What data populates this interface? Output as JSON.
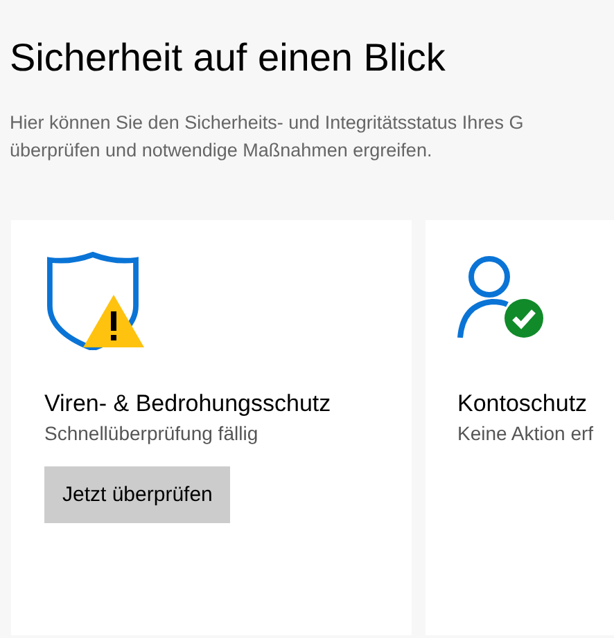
{
  "title": "Sicherheit auf einen Blick",
  "description_lines": [
    "Hier können Sie den Sicherheits- und Integritätsstatus Ihres G",
    "überprüfen und notwendige Maßnahmen ergreifen."
  ],
  "cards": [
    {
      "kind": "warning",
      "title": "Viren- & Bedrohungsschutz",
      "status": "Schnellüberprüfung fällig",
      "button": "Jetzt überprüfen"
    },
    {
      "kind": "ok",
      "title": "Kontoschutz",
      "status": "Keine Aktion erf"
    }
  ]
}
